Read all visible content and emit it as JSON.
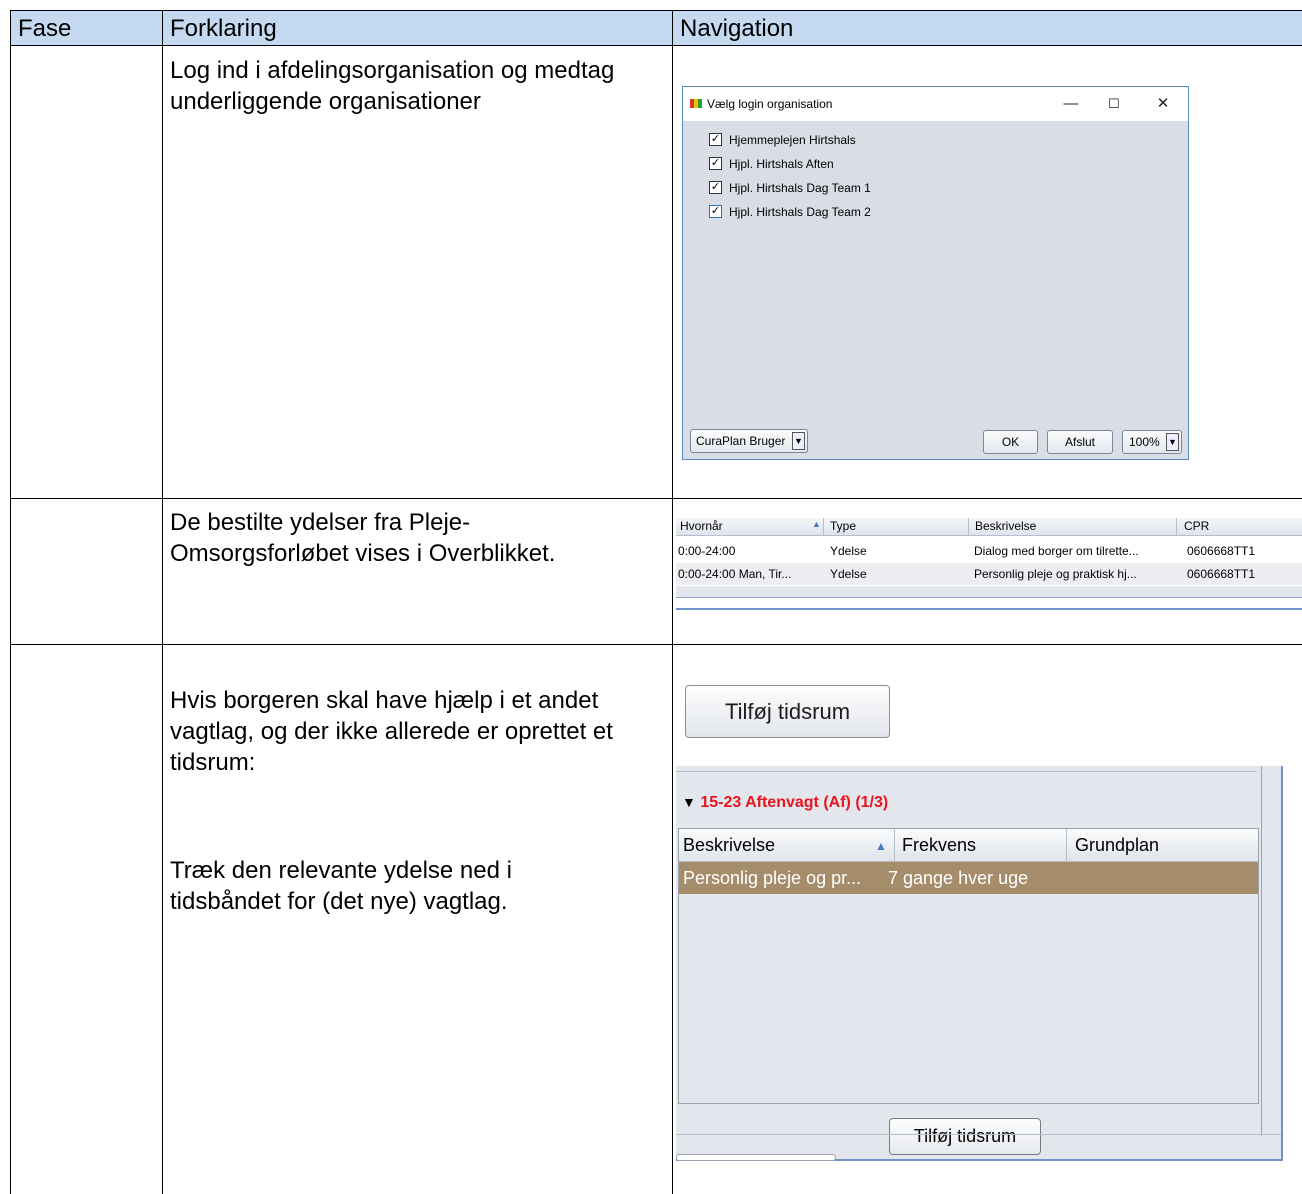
{
  "table": {
    "headers": [
      "Fase",
      "Forklaring",
      "Navigation"
    ],
    "rows": [
      {
        "fase": "",
        "forklaring_lines": [
          "Log ind i afdelingsorganisation og medtag",
          "underliggende organisationer"
        ]
      },
      {
        "fase": "",
        "forklaring_lines": [
          "De bestilte ydelser fra Pleje-",
          "Omsorgsforløbet vises i Overblikket."
        ]
      },
      {
        "fase": "",
        "forklaring_lines": [
          "Hvis borgeren skal have hjælp i et andet",
          "vagtlag, og der ikke allerede er oprettet et",
          "tidsrum:"
        ],
        "forklaring_lines_2": [
          "Træk den relevante ydelse ned i",
          "tidsbåndet for (det nye) vagtlag."
        ]
      }
    ]
  },
  "login_dialog": {
    "title": "Vælg login organisation",
    "window_buttons": [
      "—",
      "☐",
      "✕"
    ],
    "organisations": [
      {
        "label": "Hjemmeplejen Hirtshals",
        "checked": true
      },
      {
        "label": "Hjpl. Hirtshals Aften",
        "checked": true
      },
      {
        "label": "Hjpl. Hirtshals Dag Team 1",
        "checked": true
      },
      {
        "label": "Hjpl. Hirtshals Dag Team 2",
        "checked": true
      }
    ],
    "user_dropdown": "CuraPlan Bruger",
    "ok_label": "OK",
    "exit_label": "Afslut",
    "zoom_dropdown": "100%"
  },
  "overview_table": {
    "columns": [
      "Hvornår",
      "Type",
      "Beskrivelse",
      "CPR"
    ],
    "sort_indicator": "▲",
    "rows": [
      [
        "0:00-24:00",
        "Ydelse",
        "Dialog med borger om tilrette...",
        "0606668TT1"
      ],
      [
        "0:00-24:00 Man, Tir...",
        "Ydelse",
        "Personlig pleje og praktisk hj...",
        "0606668TT1"
      ]
    ]
  },
  "add_timespan_button": "Tilføj tidsrum",
  "shift_panel": {
    "title": "15-23 Aftenvagt (Af)",
    "count": "(1/3)",
    "toggle": "▼",
    "columns": [
      "Beskrivelse",
      "Frekvens",
      "Grundplan"
    ],
    "sort_indicator": "▲",
    "rows": [
      [
        "Personlig pleje og pr...",
        "7 gange hver uge",
        ""
      ]
    ],
    "button": "Tilføj tidsrum",
    "colors": {
      "title": "#e8141e",
      "selected_row": "#a58c6a"
    }
  }
}
